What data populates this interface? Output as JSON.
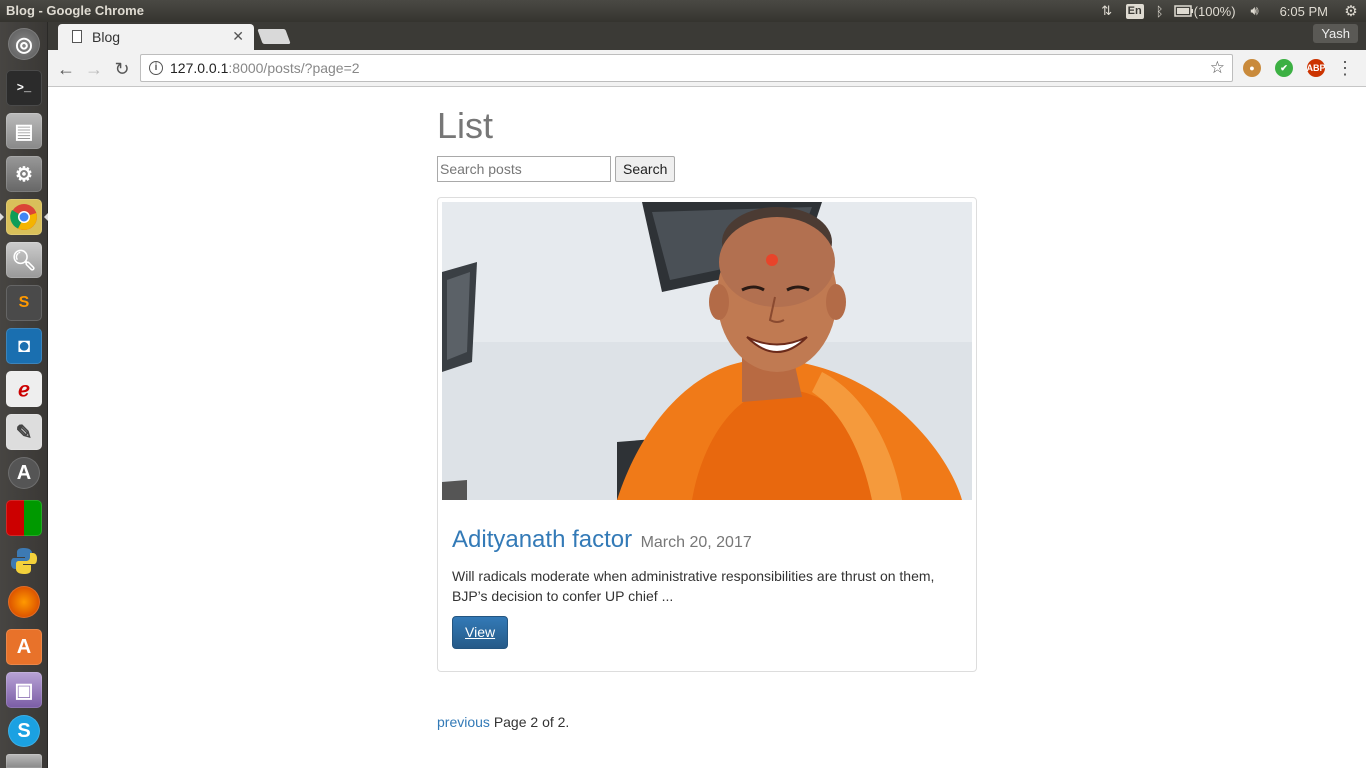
{
  "system": {
    "window_title": "Blog - Google Chrome",
    "lang": "En",
    "battery": "(100%)",
    "clock": "6:05 PM"
  },
  "browser": {
    "tab_title": "Blog",
    "profile_name": "Yash",
    "url_host": "127.0.0.1",
    "url_rest": ":8000/posts/?page=2",
    "extensions": [
      "cookie-icon",
      "check-icon",
      "abp-icon"
    ],
    "abp_label": "ABP"
  },
  "page": {
    "title": "List",
    "search": {
      "placeholder": "Search posts",
      "button_label": "Search"
    },
    "posts": [
      {
        "title": "Adityanath factor",
        "date": "March 20, 2017",
        "excerpt": "Will radicals moderate when administrative responsibilities are thrust on them, BJP’s decision to confer UP chief ...",
        "view_label": "View"
      }
    ],
    "pagination": {
      "previous_label": "previous",
      "status": "Page 2 of 2."
    }
  },
  "launcher": {
    "apps": [
      "dash-icon",
      "terminal-icon",
      "files-icon",
      "system-settings-icon",
      "chrome-icon",
      "image-viewer-icon",
      "sublime-text-icon",
      "screenshot-icon",
      "document-viewer-icon",
      "text-editor-icon",
      "software-updater-icon",
      "workspaces-icon",
      "python-icon",
      "firefox-icon",
      "software-center-icon",
      "video-icon",
      "skype-icon",
      "drive-icon"
    ]
  },
  "colors": {
    "link": "#337ab7",
    "button_primary": "#337ab7",
    "panel_bg": "#3c3b37"
  }
}
